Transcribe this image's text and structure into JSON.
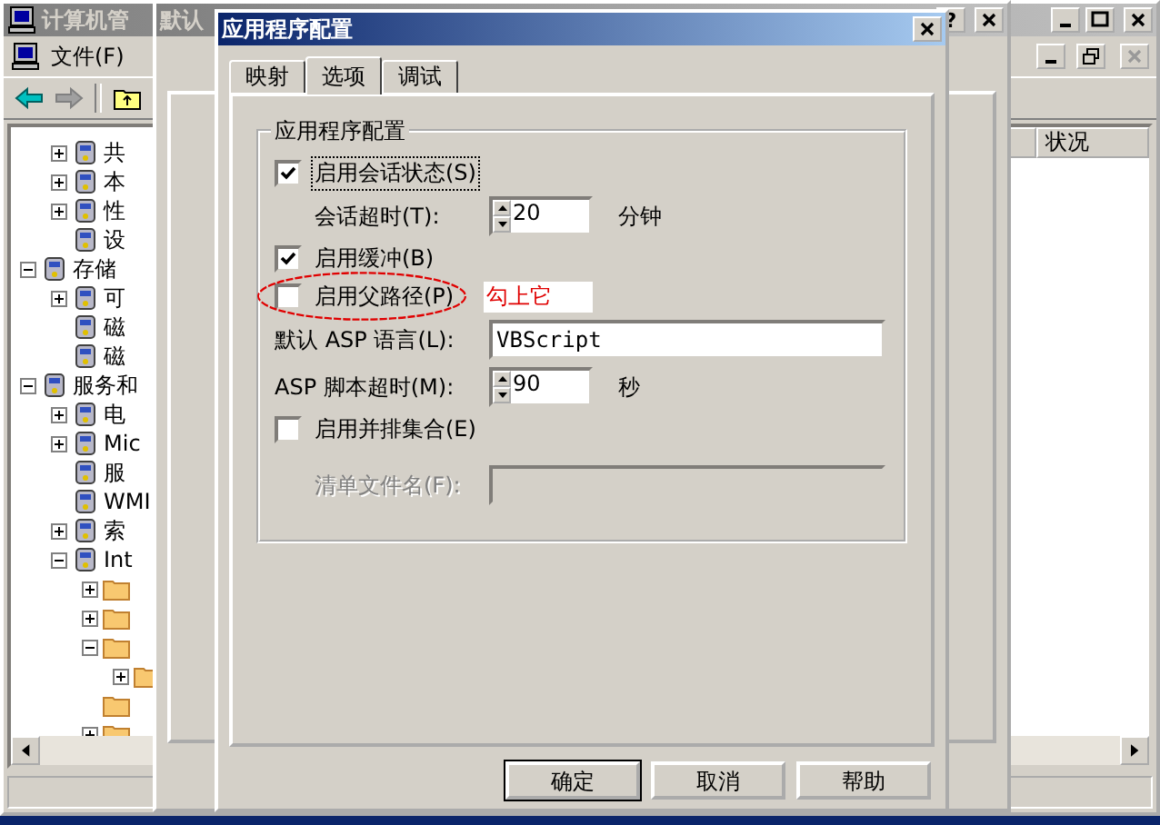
{
  "main_window": {
    "title": "计算机管",
    "menu": [
      "文件(F)"
    ],
    "tree": [
      {
        "label": "共",
        "kind": "collapsed",
        "indent": true
      },
      {
        "label": "本",
        "kind": "collapsed",
        "indent": true
      },
      {
        "label": "性",
        "kind": "collapsed",
        "indent": true
      },
      {
        "label": "设",
        "kind": "leaf",
        "indent": true
      },
      {
        "label": "存储",
        "kind": "expanded",
        "children": [
          {
            "label": "可",
            "kind": "collapsed"
          },
          {
            "label": "磁",
            "kind": "leaf"
          },
          {
            "label": "磁",
            "kind": "leaf"
          }
        ]
      },
      {
        "label": "服务和",
        "kind": "expanded",
        "children": [
          {
            "label": "电",
            "kind": "collapsed"
          },
          {
            "label": "Mic",
            "kind": "collapsed"
          },
          {
            "label": "服",
            "kind": "leaf"
          },
          {
            "label": "WMI",
            "kind": "leaf"
          },
          {
            "label": "索",
            "kind": "collapsed"
          },
          {
            "label": "Int",
            "kind": "expanded",
            "children": [
              {
                "kind": "collapsed"
              },
              {
                "kind": "collapsed"
              },
              {
                "kind": "expanded",
                "children": [
                  {
                    "kind": "collapsed"
                  }
                ]
              },
              {
                "kind": "leaf"
              },
              {
                "kind": "collapsed"
              }
            ]
          }
        ]
      }
    ],
    "list_columns": [
      "状况"
    ]
  },
  "back_dialog": {
    "title": "默认",
    "help_button": "?"
  },
  "dialog": {
    "title": "应用程序配置",
    "tabs": [
      {
        "label": "映射",
        "selected": false
      },
      {
        "label": "选项",
        "selected": true
      },
      {
        "label": "调试",
        "selected": false
      }
    ],
    "group_title": "应用程序配置",
    "options": [
      {
        "kind": "checkbox",
        "label": "启用会话状态(S)",
        "checked": true,
        "focused": true,
        "children": [
          {
            "kind": "spinner",
            "label": "会话超时(T):",
            "value": "20",
            "unit": "分钟"
          }
        ]
      },
      {
        "kind": "checkbox",
        "label": "启用缓冲(B)",
        "checked": true,
        "focused": false
      },
      {
        "kind": "checkbox",
        "label": "启用父路径(P)",
        "checked": false,
        "focused": false,
        "annotation": "勾上它"
      },
      {
        "kind": "text",
        "label": "默认 ASP 语言(L):",
        "value": "VBScript",
        "disabled": false
      },
      {
        "kind": "spinner",
        "label": "ASP 脚本超时(M):",
        "value": "90",
        "unit": "秒"
      },
      {
        "kind": "checkbox",
        "label": "启用并排集合(E)",
        "checked": false,
        "focused": false,
        "children": [
          {
            "kind": "text",
            "label": "清单文件名(F):",
            "disabled": true
          }
        ]
      }
    ],
    "buttons": [
      {
        "label": "确定",
        "default": true
      },
      {
        "label": "取消",
        "default": false
      },
      {
        "label": "帮助",
        "default": false
      }
    ]
  }
}
